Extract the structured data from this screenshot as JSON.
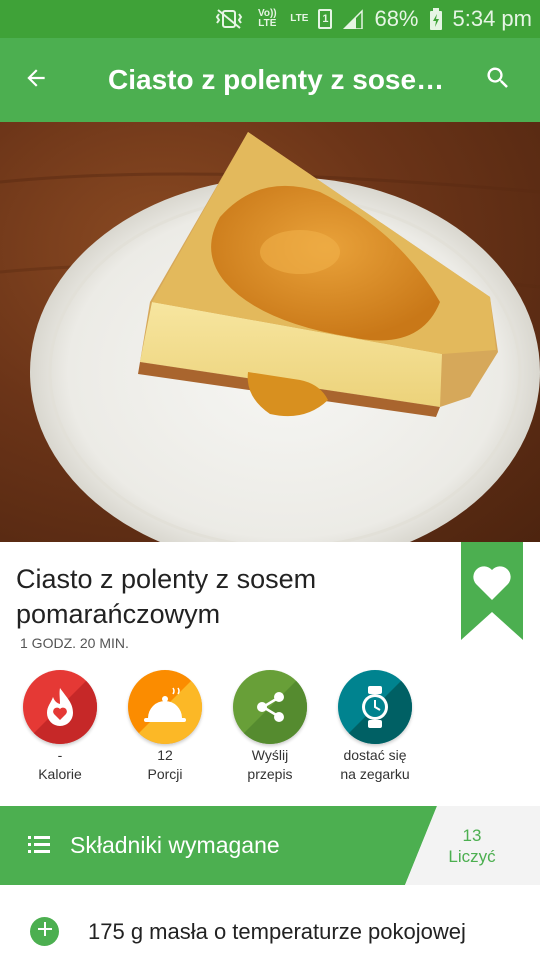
{
  "status_bar": {
    "volte": "Vo)) LTE",
    "lte": "LTE",
    "sim": "1",
    "battery": "68%",
    "time": "5:34 pm"
  },
  "app_bar": {
    "title": "Ciasto z polenty z sosem pomarańczowym",
    "back_icon": "arrow-back-icon",
    "search_icon": "search-icon"
  },
  "recipe": {
    "title": "Ciasto z polenty z sosem pomarańczowym",
    "time": "1 GODZ. 20 MIN."
  },
  "actions": [
    {
      "icon": "calories-flame-icon",
      "value": "-",
      "label": "Kalorie",
      "color": "#e53935"
    },
    {
      "icon": "portions-cloche-icon",
      "value": "12",
      "label": "Porcji",
      "color": "#fb8c00"
    },
    {
      "icon": "share-icon",
      "value": "Wyślij",
      "label": "przepis",
      "color": "#689f38"
    },
    {
      "icon": "watch-icon",
      "value": "dostać się",
      "label": "na zegarku",
      "color": "#00838f"
    }
  ],
  "ingredients_header": {
    "label": "Składniki wymagane",
    "count": "13",
    "count_label": "Liczyć"
  },
  "ingredients": [
    "175 g masła o temperaturze pokojowej"
  ],
  "colors": {
    "status_bar": "#3fa238",
    "toolbar": "#4caf50",
    "accent": "#4caf50"
  }
}
